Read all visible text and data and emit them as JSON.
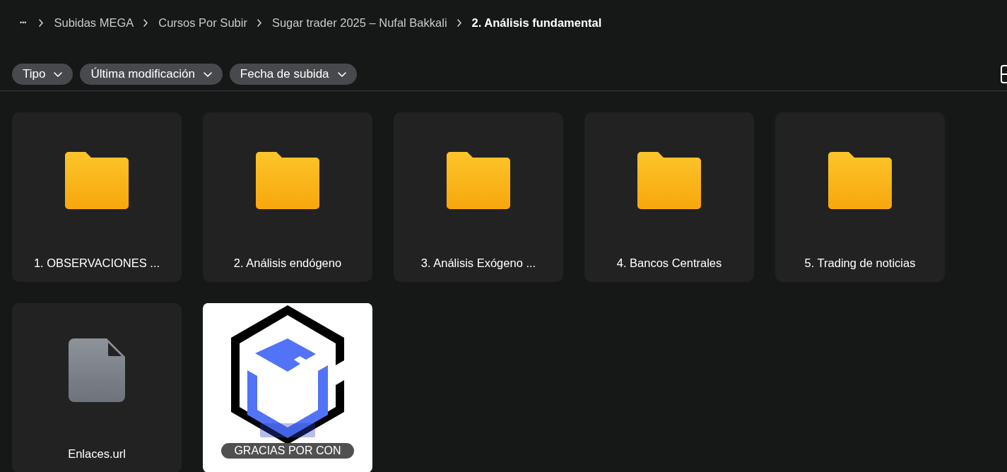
{
  "breadcrumb": {
    "more": "•••",
    "items": [
      {
        "label": "Subidas MEGA",
        "current": false
      },
      {
        "label": "Cursos Por Subir",
        "current": false
      },
      {
        "label": "Sugar trader 2025 – Nufal Bakkali",
        "current": false
      },
      {
        "label": "2. Análisis fundamental",
        "current": true
      }
    ]
  },
  "filters": [
    {
      "label": "Tipo"
    },
    {
      "label": "Última modificación"
    },
    {
      "label": "Fecha de subida"
    }
  ],
  "items": [
    {
      "kind": "folder",
      "name": "1. OBSERVACIONES ..."
    },
    {
      "kind": "folder",
      "name": "2. Análisis endógeno"
    },
    {
      "kind": "folder",
      "name": "3. Análisis Exógeno ..."
    },
    {
      "kind": "folder",
      "name": "4. Bancos Centrales"
    },
    {
      "kind": "folder",
      "name": "5. Trading de noticias"
    },
    {
      "kind": "file",
      "name": "Enlaces.url"
    },
    {
      "kind": "picture",
      "name": "GRACIAS POR CON"
    }
  ]
}
